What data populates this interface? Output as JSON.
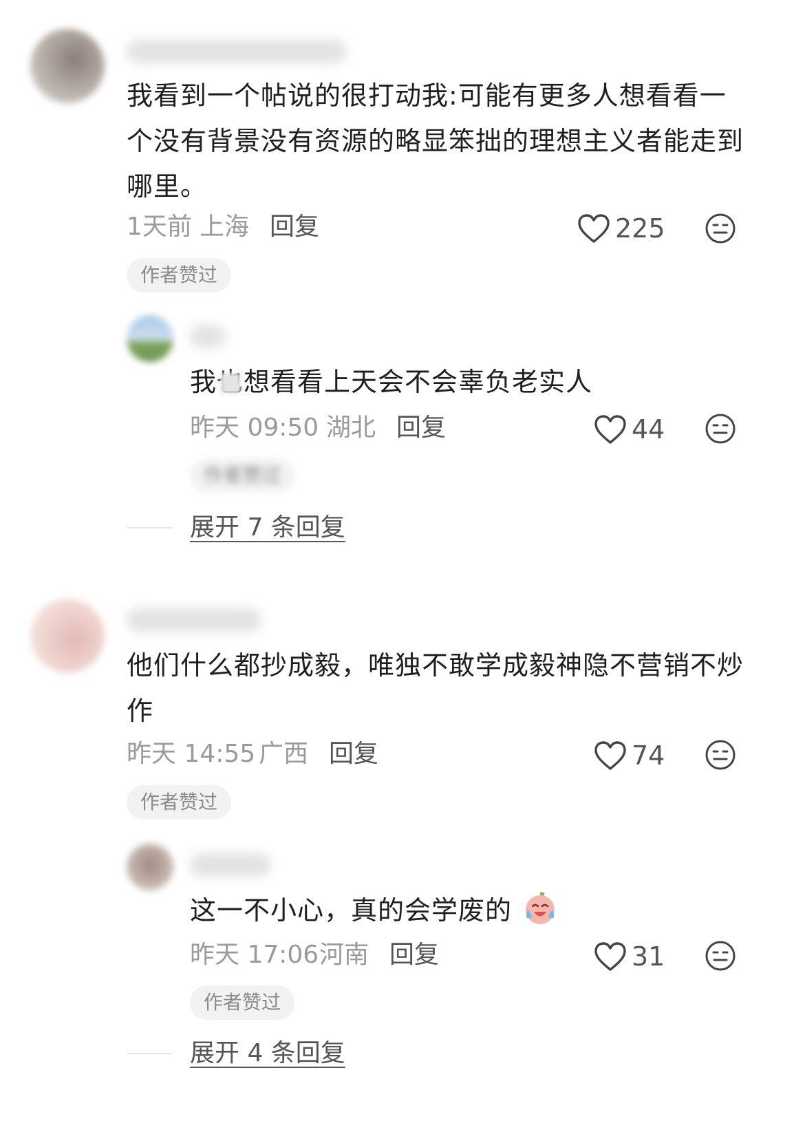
{
  "comments": [
    {
      "text": "我看到一个帖说的很打动我:可能有更多人想看看一个没有背景没有资源的略显笨拙的理想主义者能走到哪里。",
      "time": "1天前",
      "location": "上海",
      "reply_label": "回复",
      "likes": "225",
      "badge": "作者赞过",
      "replies": [
        {
          "text": "我也想看看上天会不会辜负老实人",
          "time": "昨天 09:50",
          "location": "湖北",
          "reply_label": "回复",
          "likes": "44",
          "badge": "作者赞过"
        }
      ],
      "expand_label": "展开 7 条回复"
    },
    {
      "text": "他们什么都抄成毅，唯独不敢学成毅神隐不营销不炒作",
      "time": "昨天 14:55",
      "location": "广西",
      "reply_label": "回复",
      "likes": "74",
      "badge": "作者赞过",
      "replies": [
        {
          "text": "这一不小心，真的会学废的",
          "time": "昨天 17:06",
          "location": "河南",
          "reply_label": "回复",
          "likes": "31",
          "badge": "作者赞过"
        }
      ],
      "expand_label": "展开 4 条回复"
    }
  ],
  "icons": {
    "like": "heart-outline-icon",
    "dislike": "neutral-face-icon",
    "emoji": "crying-laughing-emoji"
  },
  "colors": {
    "text": "#1f1f1f",
    "meta": "#9a9a9a",
    "badge_bg": "#f2f2f2",
    "badge_text": "#8a8a8a"
  }
}
